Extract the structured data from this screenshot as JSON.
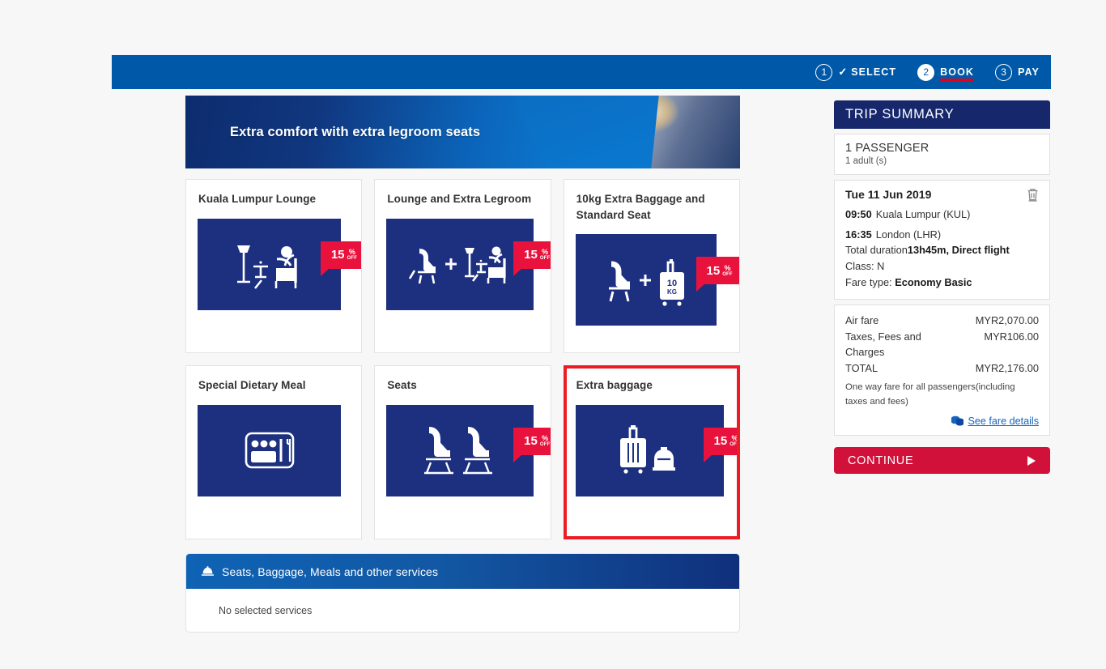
{
  "progress": {
    "steps": [
      {
        "num": "1",
        "label": "SELECT",
        "state": "done",
        "icon": "check-icon"
      },
      {
        "num": "2",
        "label": "BOOK",
        "state": "active"
      },
      {
        "num": "3",
        "label": "PAY",
        "state": "upcoming"
      }
    ]
  },
  "banner": {
    "headline": "Extra comfort with extra legroom seats"
  },
  "services": {
    "cards": [
      {
        "title": "Kuala Lumpur Lounge",
        "icon": "lounge-chair-lamp-icon",
        "badge": {
          "value": "15",
          "pct": "%",
          "off": "OFF"
        },
        "selected": false,
        "img_width": "w-narrow"
      },
      {
        "title": "Lounge and Extra Legroom",
        "icon": "seat-plus-lounge-icon",
        "badge": {
          "value": "15",
          "pct": "%",
          "off": "OFF"
        },
        "selected": false,
        "img_width": "w-mid"
      },
      {
        "title": "10kg Extra Baggage and Standard Seat",
        "icon": "seat-plus-suitcase-10kg-icon",
        "badge": {
          "value": "15",
          "pct": "%",
          "off": "OFF"
        },
        "selected": false,
        "img_width": "w-wide"
      },
      {
        "title": "Special Dietary Meal",
        "icon": "meal-tray-icon",
        "badge": null,
        "selected": false,
        "img_width": "w-narrow"
      },
      {
        "title": "Seats",
        "icon": "two-seats-icon",
        "badge": {
          "value": "15",
          "pct": "%",
          "off": "OFF"
        },
        "selected": false,
        "img_width": "w-mid"
      },
      {
        "title": "Extra baggage",
        "icon": "suitcase-duffel-icon",
        "badge": {
          "value": "15",
          "pct": "%",
          "off": "OFF"
        },
        "selected": true,
        "img_width": "w-full"
      }
    ],
    "panel_title": "Seats, Baggage, Meals and other services",
    "panel_icon": "service-bell-icon",
    "panel_empty": "No selected services"
  },
  "trip_summary": {
    "title": "TRIP SUMMARY",
    "passenger_count": "1 PASSENGER",
    "passenger_detail": "1 adult (s)",
    "flight": {
      "date": "Tue 11 Jun 2019",
      "delete_icon": "trash-icon",
      "depart_time": "09:50",
      "depart_city": "Kuala Lumpur (KUL)",
      "arrive_time": "16:35",
      "arrive_city": "London (LHR)",
      "duration_label": "Total  duration",
      "duration_value": "13h45m, Direct flight",
      "class_label": "Class:",
      "class_value": "N",
      "fare_type_label": "Fare type:",
      "fare_type_value": "Economy Basic"
    },
    "fare": {
      "air_fare_label": "Air fare",
      "air_fare_value": "MYR2,070.00",
      "taxes_label": "Taxes, Fees and Charges",
      "taxes_value": "MYR106.00",
      "total_label": "TOTAL",
      "total_value": "MYR2,176.00",
      "note": "One way fare for all passengers(including taxes and fees)",
      "link": "See fare details",
      "link_icon": "coins-icon"
    },
    "continue_label": "CONTINUE",
    "continue_icon": "play-triangle-icon"
  },
  "colors": {
    "header_blue": "#0059a8",
    "navy": "#16276b",
    "icon_panel_navy": "#1d2f7f",
    "badge_red": "#e8123c",
    "selected_red": "#ed1c24",
    "continue_red": "#d2113a",
    "link_blue": "#1565c0",
    "page_bg": "#f7f7f7"
  }
}
